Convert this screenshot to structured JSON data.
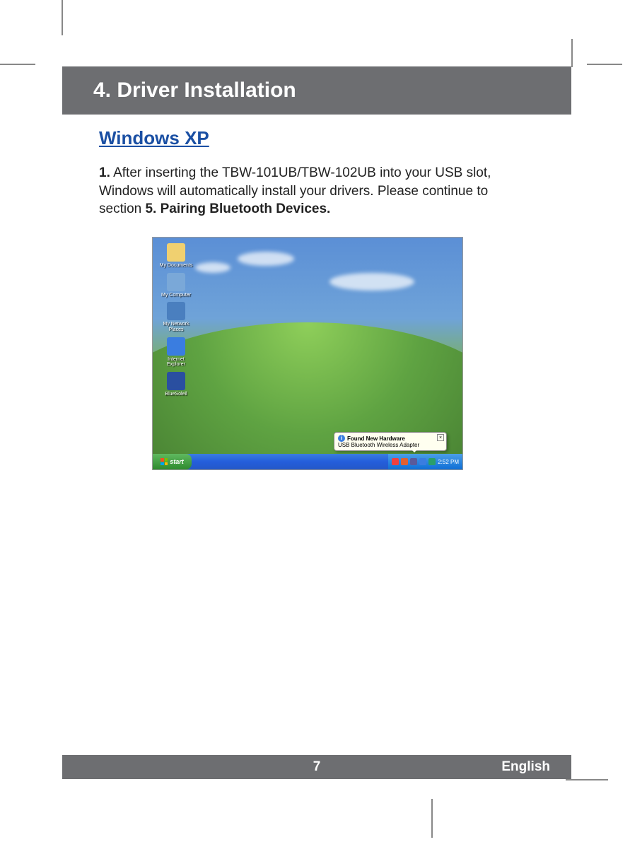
{
  "header": {
    "title": "4. Driver Installation"
  },
  "subheading": "Windows XP",
  "step": {
    "number": "1.",
    "text_a": "After inserting the TBW-101UB/TBW-102UB into your USB slot, Windows will automatically install your drivers.  Please continue to section ",
    "text_bold": "5. Pairing Bluetooth Devices."
  },
  "screenshot": {
    "desktop_icons": [
      {
        "label": "My Documents",
        "color": "#f0d070"
      },
      {
        "label": "My Computer",
        "color": "#7aa8d8"
      },
      {
        "label": "My Network Places",
        "color": "#4a7fbf"
      },
      {
        "label": "Internet Explorer",
        "color": "#3a7de0"
      },
      {
        "label": "BlueSoleil",
        "color": "#2a4fa0"
      }
    ],
    "start_label": "start",
    "balloon": {
      "title": "Found New Hardware",
      "body": "USB Bluetooth Wireless Adapter",
      "close": "×"
    },
    "tray": {
      "time": "2:52 PM",
      "icons": [
        "#f04040",
        "#e06030",
        "#5a5a9a",
        "#3a7de0",
        "#2a9f6a"
      ]
    }
  },
  "footer": {
    "page": "7",
    "language": "English"
  }
}
